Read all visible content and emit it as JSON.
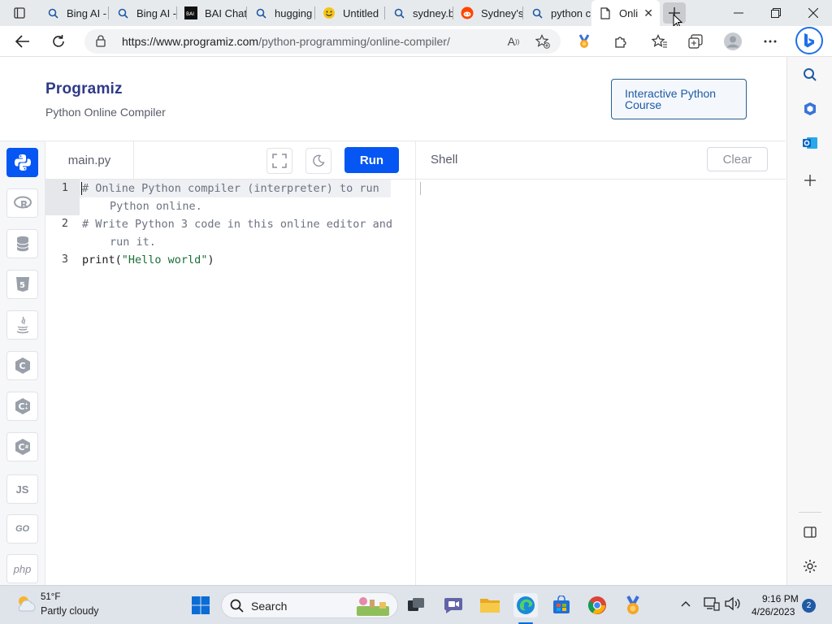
{
  "browser": {
    "tabs": [
      {
        "title": "Bing AI -",
        "favicon": "bing-search-icon"
      },
      {
        "title": "Bing AI -",
        "favicon": "bing-search-icon"
      },
      {
        "title": "BAI Chat",
        "favicon": "bai-logo-icon"
      },
      {
        "title": "hugging",
        "favicon": "search-icon"
      },
      {
        "title": "Untitled",
        "favicon": "smiley-icon"
      },
      {
        "title": "sydney.b",
        "favicon": "search-icon"
      },
      {
        "title": "Sydney's",
        "favicon": "reddit-icon"
      },
      {
        "title": "python c",
        "favicon": "search-icon"
      },
      {
        "title": "Onli",
        "favicon": "page-icon"
      }
    ],
    "url_host": "https://www.programiz.com",
    "url_path": "/python-programming/online-compiler/"
  },
  "site": {
    "logo": "Programiz",
    "subtitle": "Python Online Compiler",
    "course_button": "Interactive Python Course"
  },
  "languages": [
    {
      "name": "python",
      "label": "",
      "active": true
    },
    {
      "name": "r",
      "label": "R"
    },
    {
      "name": "sql",
      "label": ""
    },
    {
      "name": "html",
      "label": "5"
    },
    {
      "name": "java",
      "label": ""
    },
    {
      "name": "c",
      "label": "C"
    },
    {
      "name": "cpp",
      "label": "C"
    },
    {
      "name": "csharp",
      "label": "C"
    },
    {
      "name": "javascript",
      "label": "JS"
    },
    {
      "name": "go",
      "label": "GO"
    },
    {
      "name": "php",
      "label": "php"
    }
  ],
  "editor": {
    "file_name": "main.py",
    "run_label": "Run",
    "line_numbers": [
      "1",
      "2",
      "3"
    ],
    "lines": [
      "# Online Python compiler (interpreter) to run",
      "Python online.",
      "# Write Python 3 code in this online editor and",
      "run it.",
      "print(",
      "\"Hello world\"",
      ")"
    ]
  },
  "shell": {
    "title": "Shell",
    "clear_label": "Clear"
  },
  "taskbar": {
    "temperature": "51°F",
    "weather": "Partly cloudy",
    "search_label": "Search",
    "time": "9:16 PM",
    "date": "4/26/2023",
    "notifications": "2"
  },
  "colors": {
    "accent": "#0556f3",
    "logo": "#2e3a87",
    "course_border": "#2a5f8f"
  }
}
